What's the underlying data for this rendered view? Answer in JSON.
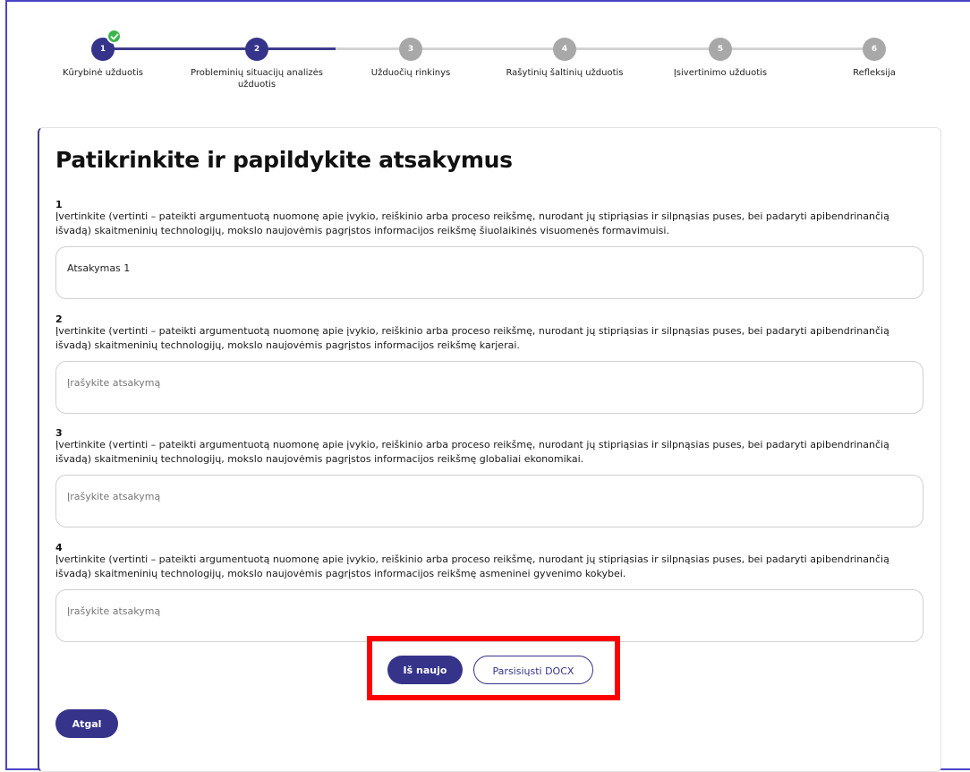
{
  "stepper": {
    "steps": [
      {
        "number": "1",
        "label": "Kūrybinė užduotis",
        "status": "done"
      },
      {
        "number": "2",
        "label": "Probleminių situacijų analizės užduotis",
        "status": "active"
      },
      {
        "number": "3",
        "label": "Užduočių rinkinys",
        "status": "todo"
      },
      {
        "number": "4",
        "label": "Rašytinių šaltinių užduotis",
        "status": "todo"
      },
      {
        "number": "5",
        "label": "Įsivertinimo užduotis",
        "status": "todo"
      },
      {
        "number": "6",
        "label": "Refleksija",
        "status": "todo"
      }
    ]
  },
  "page": {
    "title": "Patikrinkite ir papildykite atsakymus"
  },
  "questions": [
    {
      "number": "1",
      "text": "Įvertinkite (vertinti – pateikti argumentuotą nuomonę apie įvykio, reiškinio arba proceso reikšmę, nurodant jų stipriąsias ir silpnąsias puses, bei padaryti apibendrinančią išvadą) skaitmeninių technologijų, mokslo naujovėmis pagrįstos informacijos reikšmę šiuolaikinės visuomenės formavimuisi.",
      "answer": "Atsakymas 1",
      "placeholder": "Įrašykite atsakymą"
    },
    {
      "number": "2",
      "text": "Įvertinkite (vertinti – pateikti argumentuotą nuomonę apie įvykio, reiškinio arba proceso reikšmę, nurodant jų stipriąsias ir silpnąsias puses, bei padaryti apibendrinančią išvadą) skaitmeninių technologijų, mokslo naujovėmis pagrįstos informacijos reikšmę karjerai.",
      "answer": "",
      "placeholder": "Įrašykite atsakymą"
    },
    {
      "number": "3",
      "text": "Įvertinkite (vertinti – pateikti argumentuotą nuomonę apie įvykio, reiškinio arba proceso reikšmę, nurodant jų stipriąsias ir silpnąsias puses, bei padaryti apibendrinančią išvadą) skaitmeninių technologijų, mokslo naujovėmis pagrįstos informacijos reikšmę globaliai ekonomikai.",
      "answer": "",
      "placeholder": "Įrašykite atsakymą"
    },
    {
      "number": "4",
      "text": "Įvertinkite (vertinti – pateikti argumentuotą nuomonę apie įvykio, reiškinio arba proceso reikšmę, nurodant jų stipriąsias ir silpnąsias puses, bei padaryti apibendrinančią išvadą) skaitmeninių technologijų, mokslo naujovėmis pagrįstos informacijos reikšmę asmeninei gyvenimo kokybei.",
      "answer": "",
      "placeholder": "Įrašykite atsakymą"
    }
  ],
  "actions": {
    "restart_label": "Iš naujo",
    "download_label": "Parsisiųsti DOCX",
    "back_label": "Atgal"
  },
  "colors": {
    "primary": "#35348a",
    "step_todo": "#a8a8a8",
    "check": "#3bb54a",
    "highlight": "#ff0000",
    "frame": "#4a45c8"
  },
  "icons": {
    "completed_step": "check-icon"
  }
}
